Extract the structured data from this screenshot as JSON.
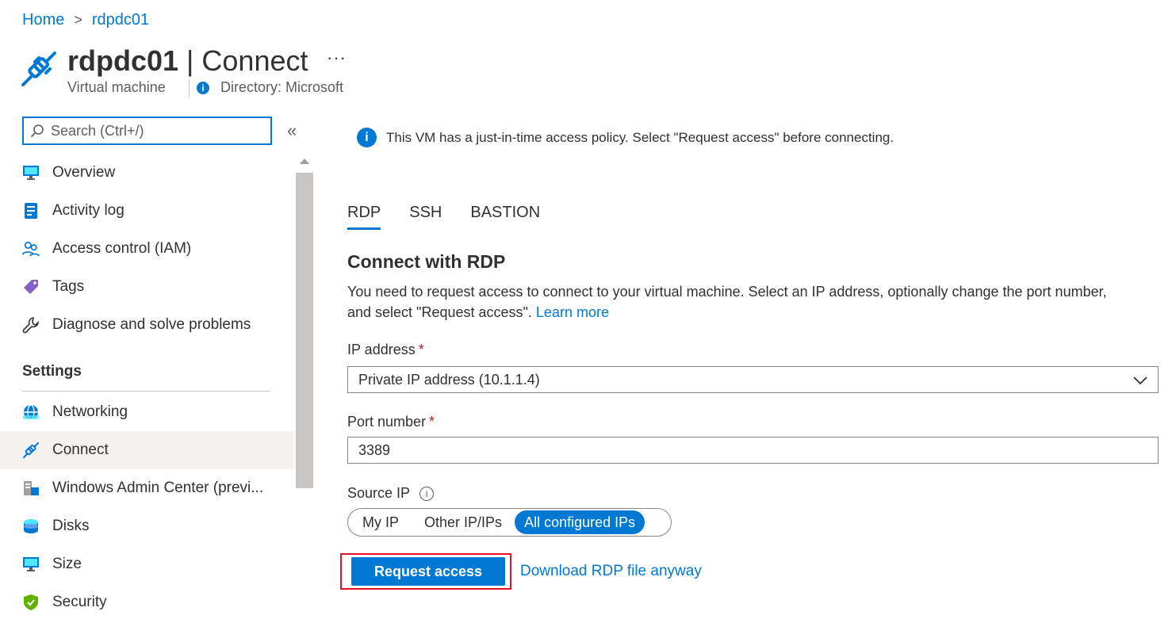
{
  "breadcrumb": {
    "home": "Home",
    "separator": ">",
    "current": "rdpdc01"
  },
  "header": {
    "vm_name": "rdpdc01",
    "title_sep": " | ",
    "page": "Connect",
    "more": "···",
    "resource_type": "Virtual machine",
    "directory": "Directory: Microsoft"
  },
  "sidebar": {
    "search_placeholder": "Search (Ctrl+/)",
    "collapse": "«",
    "items": [
      {
        "label": "Overview",
        "icon": "monitor-icon"
      },
      {
        "label": "Activity log",
        "icon": "log-icon"
      },
      {
        "label": "Access control (IAM)",
        "icon": "people-icon"
      },
      {
        "label": "Tags",
        "icon": "tag-icon"
      },
      {
        "label": "Diagnose and solve problems",
        "icon": "wrench-icon"
      }
    ],
    "settings_heading": "Settings",
    "settings_items": [
      {
        "label": "Networking",
        "icon": "globe-icon"
      },
      {
        "label": "Connect",
        "icon": "plug-icon",
        "active": true
      },
      {
        "label": "Windows Admin Center (previ...",
        "icon": "server-icon"
      },
      {
        "label": "Disks",
        "icon": "disk-icon"
      },
      {
        "label": "Size",
        "icon": "monitor-icon"
      },
      {
        "label": "Security",
        "icon": "shield-icon"
      }
    ]
  },
  "main": {
    "banner": "This VM has a just-in-time access policy. Select \"Request access\" before connecting.",
    "tabs": [
      "RDP",
      "SSH",
      "BASTION"
    ],
    "active_tab": "RDP",
    "section_title": "Connect with RDP",
    "description": "You need to request access to connect to your virtual machine. Select an IP address, optionally change the port number, and select \"Request access\".",
    "learn_more": "Learn more",
    "ip_label": "IP address",
    "ip_value": "Private IP address (10.1.1.4)",
    "port_label": "Port number",
    "port_value": "3389",
    "required_mark": "*",
    "source_label": "Source IP",
    "source_options": [
      "My IP",
      "Other IP/IPs",
      "All configured IPs"
    ],
    "source_selected": "All configured IPs",
    "request_button": "Request access",
    "download_link": "Download RDP file anyway"
  },
  "colors": {
    "accent": "#0078d4",
    "highlight_border": "#e81123",
    "required": "#a4262c"
  }
}
